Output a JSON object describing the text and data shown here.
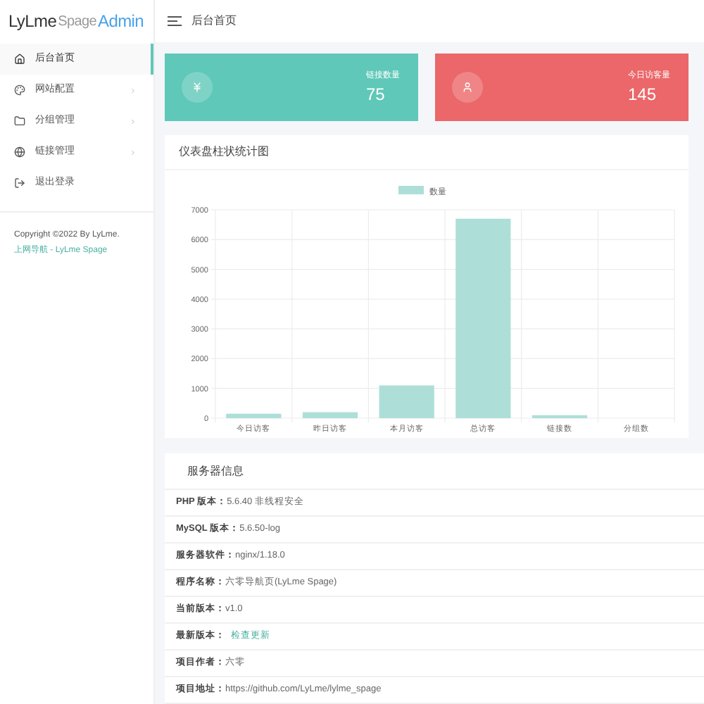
{
  "logo": {
    "part1": "LyLme",
    "part2": "Spage",
    "part3": "Admin"
  },
  "header": {
    "title": "后台首页"
  },
  "sidebar": {
    "items": [
      {
        "label": "后台首页",
        "selected": true,
        "has_children": false
      },
      {
        "label": "网站配置",
        "selected": false,
        "has_children": true
      },
      {
        "label": "分组管理",
        "selected": false,
        "has_children": true
      },
      {
        "label": "链接管理",
        "selected": false,
        "has_children": true
      },
      {
        "label": "退出登录",
        "selected": false,
        "has_children": false
      }
    ],
    "copyright": "Copyright ©2022 By LyLme.",
    "footer_link": "上网导航 - LyLme Spage"
  },
  "stats": [
    {
      "label": "链接数量",
      "value": "75",
      "color": "#5fc8b8"
    },
    {
      "label": "今日访客量",
      "value": "145",
      "color": "#eb6769"
    }
  ],
  "chart_card": {
    "title": "仪表盘柱状统计图",
    "chart_data": {
      "type": "bar",
      "categories": [
        "今日访客",
        "昨日访客",
        "本月访客",
        "总访客",
        "链接数",
        "分组数"
      ],
      "series": [
        {
          "name": "数量",
          "color": "#addfd8",
          "values": [
            150,
            200,
            1100,
            6700,
            100,
            0
          ]
        }
      ],
      "ylim": [
        0,
        7000
      ],
      "grid": true,
      "yticks": [
        0,
        1000,
        2000,
        3000,
        4000,
        5000,
        6000,
        7000
      ]
    }
  },
  "server_info": {
    "title": "服务器信息",
    "rows": [
      {
        "label": "PHP 版本：",
        "value": "5.6.40 非线程安全",
        "kind": "text"
      },
      {
        "label": "MySQL 版本：",
        "value": "5.6.50-log",
        "kind": "text"
      },
      {
        "label": "服务器软件：",
        "value": "nginx/1.18.0",
        "kind": "text"
      },
      {
        "label": "程序名称：",
        "value": "六零导航页(LyLme Spage)",
        "kind": "text"
      },
      {
        "label": "当前版本：",
        "value": "v1.0",
        "kind": "text"
      },
      {
        "label": "最新版本：",
        "value": "检查更新",
        "kind": "link"
      },
      {
        "label": "项目作者：",
        "value": "六零",
        "kind": "text"
      },
      {
        "label": "项目地址：",
        "value": "https://github.com/LyLme/lylme_spage",
        "kind": "text"
      }
    ]
  }
}
